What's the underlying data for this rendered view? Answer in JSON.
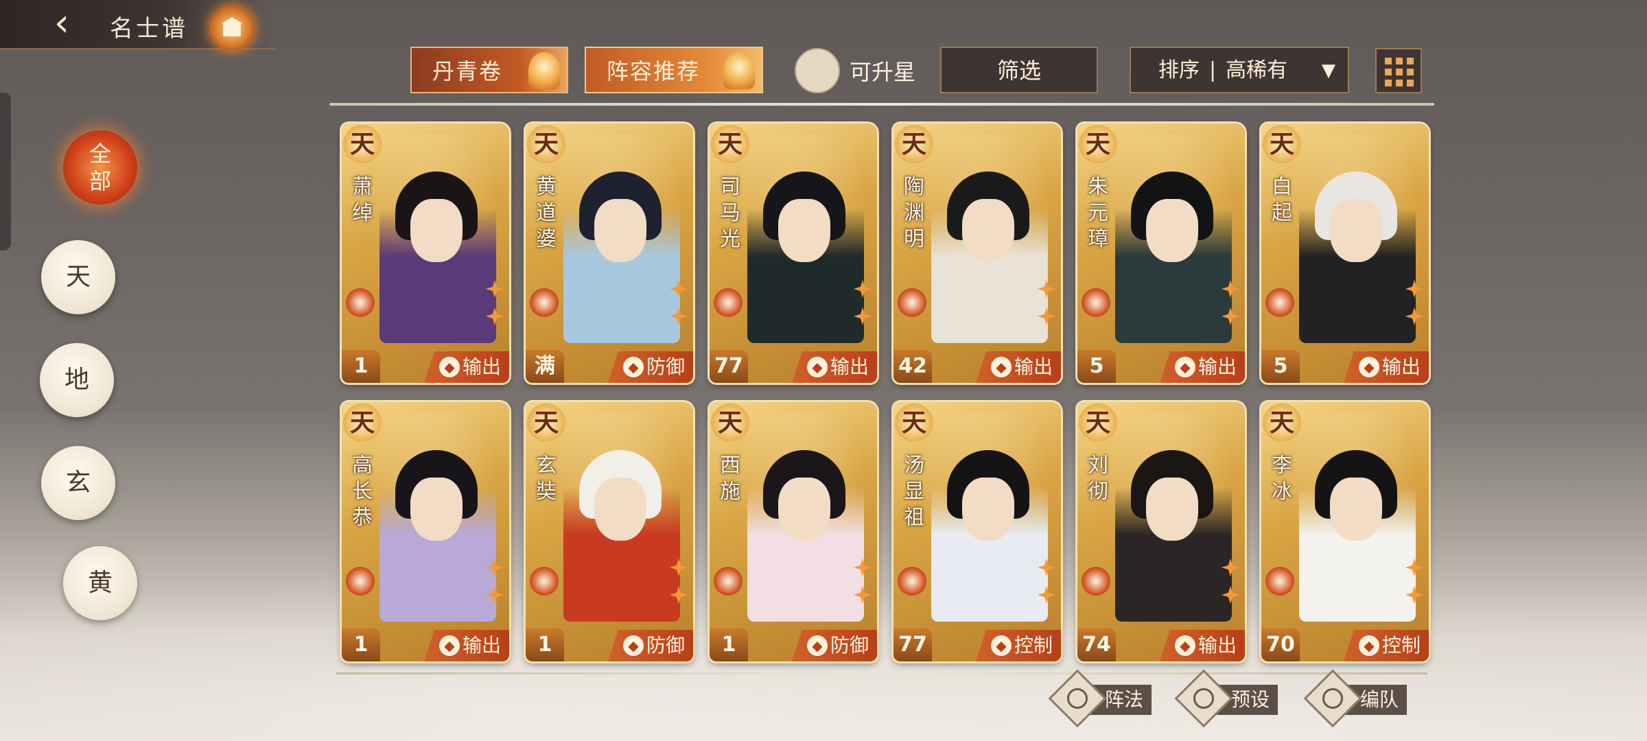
{
  "header": {
    "title": "名士谱",
    "back_icon": "back-arrow-icon",
    "emblem_icon": "pavilion-icon"
  },
  "top_bar": {
    "album_label": "丹青卷",
    "lineup_label": "阵容推荐",
    "upgradable_label": "可升星",
    "filter_label": "筛选",
    "sort_label": "排序",
    "sort_value": "高稀有",
    "sort_separator": "|"
  },
  "rank_filters": [
    {
      "label": "全部",
      "active": true
    },
    {
      "label": "天",
      "active": false
    },
    {
      "label": "地",
      "active": false
    },
    {
      "label": "玄",
      "active": false
    },
    {
      "label": "黄",
      "active": false
    }
  ],
  "tier_badge": "天",
  "cards": [
    {
      "name": "萧绰",
      "level": "1",
      "role": "输出",
      "role_icon": "sword-icon",
      "hair": "#1a1416",
      "robe": "#5b3a7a"
    },
    {
      "name": "黄道婆",
      "level": "满",
      "role": "防御",
      "role_icon": "shield-icon",
      "hair": "#1d2130",
      "robe": "#a8c8e0"
    },
    {
      "name": "司马光",
      "level": "77",
      "role": "输出",
      "role_icon": "sword-icon",
      "hair": "#15161a",
      "robe": "#1f2a2a"
    },
    {
      "name": "陶渊明",
      "level": "42",
      "role": "输出",
      "role_icon": "sword-icon",
      "hair": "#1b1a1a",
      "robe": "#e9e2d6"
    },
    {
      "name": "朱元璋",
      "level": "5",
      "role": "输出",
      "role_icon": "sword-icon",
      "hair": "#121314",
      "robe": "#2b3a3a"
    },
    {
      "name": "白起",
      "level": "5",
      "role": "输出",
      "role_icon": "sword-icon",
      "hair": "#e9e6e2",
      "robe": "#222222"
    },
    {
      "name": "高长恭",
      "level": "1",
      "role": "输出",
      "role_icon": "sword-icon",
      "hair": "#17151a",
      "robe": "#b8a9d6"
    },
    {
      "name": "玄奘",
      "level": "1",
      "role": "防御",
      "role_icon": "shield-icon",
      "hair": "#f2efe8",
      "robe": "#c83a22"
    },
    {
      "name": "西施",
      "level": "1",
      "role": "防御",
      "role_icon": "shield-icon",
      "hair": "#1a1619",
      "robe": "#f3dfe3"
    },
    {
      "name": "汤显祖",
      "level": "77",
      "role": "控制",
      "role_icon": "control-icon",
      "hair": "#141416",
      "robe": "#e8ecf2"
    },
    {
      "name": "刘彻",
      "level": "74",
      "role": "输出",
      "role_icon": "sword-icon",
      "hair": "#1a1613",
      "robe": "#2b2625"
    },
    {
      "name": "李冰",
      "level": "70",
      "role": "控制",
      "role_icon": "control-icon",
      "hair": "#151414",
      "robe": "#f4f2ef"
    }
  ],
  "bottom_actions": [
    {
      "label": "阵法",
      "icon": "formation-icon"
    },
    {
      "label": "预设",
      "icon": "preset-icon"
    },
    {
      "label": "编队",
      "icon": "team-flag-icon"
    }
  ],
  "colors": {
    "accent": "#d4451c",
    "card_gold": "#d9a544",
    "role_bg": "#c0491c"
  }
}
